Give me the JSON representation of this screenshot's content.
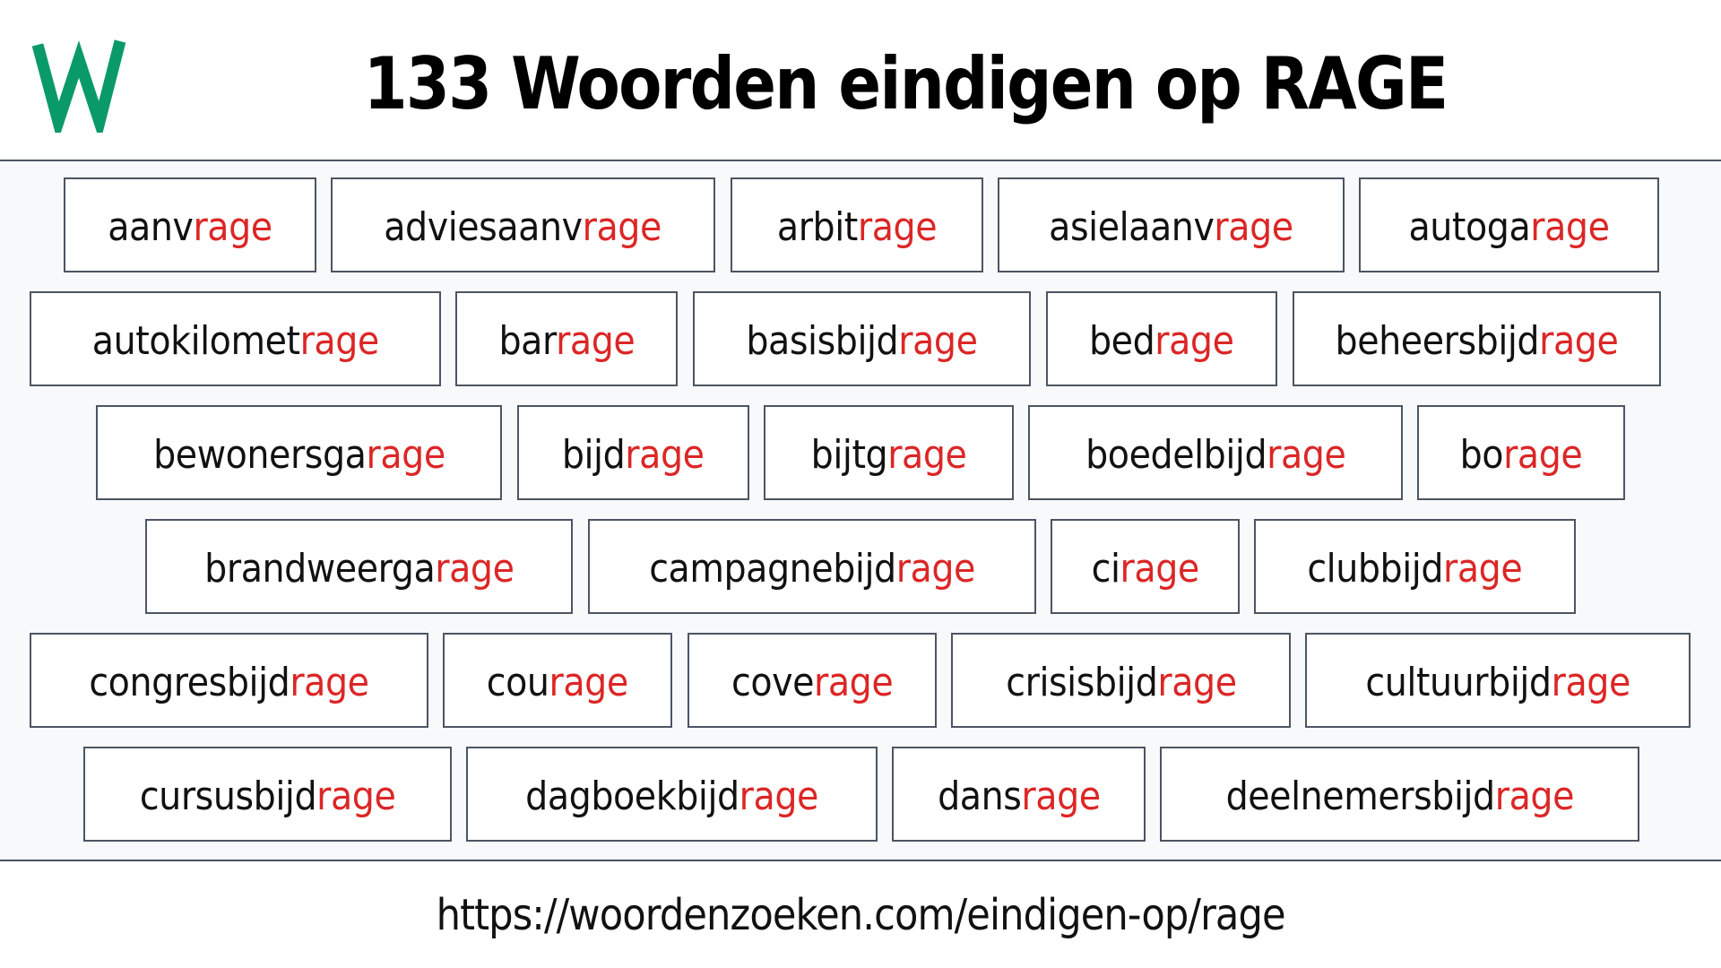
{
  "header": {
    "logo_letter": "W",
    "logo_color": "#0a9a6a",
    "title": "133 Woorden eindigen op RAGE"
  },
  "suffix": "rage",
  "colors": {
    "suffix": "#dc2626",
    "text": "#111111",
    "border": "#4b5563",
    "background": "#f8f9fb"
  },
  "rows": [
    [
      {
        "prefix": "aanv",
        "suffix": "rage"
      },
      {
        "prefix": "adviesaanv",
        "suffix": "rage"
      },
      {
        "prefix": "arbit",
        "suffix": "rage"
      },
      {
        "prefix": "asielaanv",
        "suffix": "rage"
      },
      {
        "prefix": "autoga",
        "suffix": "rage"
      }
    ],
    [
      {
        "prefix": "autokilomet",
        "suffix": "rage"
      },
      {
        "prefix": "bar",
        "suffix": "rage"
      },
      {
        "prefix": "basisbijd",
        "suffix": "rage"
      },
      {
        "prefix": "bed",
        "suffix": "rage"
      },
      {
        "prefix": "beheersbijd",
        "suffix": "rage"
      }
    ],
    [
      {
        "prefix": "bewonersga",
        "suffix": "rage"
      },
      {
        "prefix": "bijd",
        "suffix": "rage"
      },
      {
        "prefix": "bijtg",
        "suffix": "rage"
      },
      {
        "prefix": "boedelbijd",
        "suffix": "rage"
      },
      {
        "prefix": "bo",
        "suffix": "rage"
      }
    ],
    [
      {
        "prefix": "brandweerga",
        "suffix": "rage"
      },
      {
        "prefix": "campagnebijd",
        "suffix": "rage"
      },
      {
        "prefix": "ci",
        "suffix": "rage"
      },
      {
        "prefix": "clubbijd",
        "suffix": "rage"
      }
    ],
    [
      {
        "prefix": "congresbijd",
        "suffix": "rage"
      },
      {
        "prefix": "cou",
        "suffix": "rage"
      },
      {
        "prefix": "cove",
        "suffix": "rage"
      },
      {
        "prefix": "crisisbijd",
        "suffix": "rage"
      },
      {
        "prefix": "cultuurbijd",
        "suffix": "rage"
      }
    ],
    [
      {
        "prefix": "cursusbijd",
        "suffix": "rage"
      },
      {
        "prefix": "dagboekbijd",
        "suffix": "rage"
      },
      {
        "prefix": "dans",
        "suffix": "rage"
      },
      {
        "prefix": "deelnemersbijd",
        "suffix": "rage"
      }
    ]
  ],
  "footer": {
    "url": "https://woordenzoeken.com/eindigen-op/rage"
  }
}
